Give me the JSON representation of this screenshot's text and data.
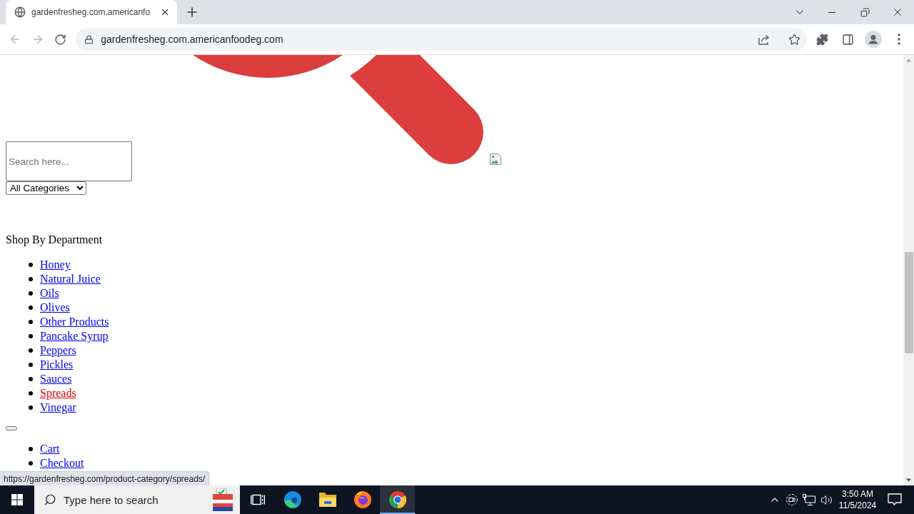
{
  "browser": {
    "tabs": [
      {
        "title": "gardenfresheg.com.americanfo",
        "selected": true
      }
    ],
    "nav_buttons": [
      {
        "kind": "back",
        "disabled": true
      },
      {
        "kind": "forward",
        "disabled": true
      },
      {
        "kind": "reload",
        "disabled": false
      }
    ],
    "address": "gardenfresheg.com.americanfoodeg.com",
    "status_url": "https://gardenfresheg.com/product-category/spreads/"
  },
  "page": {
    "search": {
      "placeholder": "Search here..."
    },
    "category_select": {
      "value": "All Categories"
    },
    "heading": "Shop By Department",
    "departments": [
      {
        "label": "Honey",
        "hovered": false
      },
      {
        "label": "Natural Juice",
        "hovered": false
      },
      {
        "label": "Oils",
        "hovered": false
      },
      {
        "label": "Olives",
        "hovered": false
      },
      {
        "label": "Other Products",
        "hovered": false
      },
      {
        "label": "Pancake Syrup",
        "hovered": false
      },
      {
        "label": "Peppers",
        "hovered": false
      },
      {
        "label": "Pickles",
        "hovered": false
      },
      {
        "label": "Sauces",
        "hovered": false
      },
      {
        "label": "Spreads",
        "hovered": true
      },
      {
        "label": "Vinegar",
        "hovered": false
      }
    ],
    "account_links": [
      {
        "label": "Cart"
      },
      {
        "label": "Checkout"
      }
    ]
  },
  "taskbar": {
    "search_placeholder": "Type here to search",
    "apps": [
      {
        "kind": "task-view",
        "active": false
      },
      {
        "kind": "edge",
        "active": false
      },
      {
        "kind": "explorer",
        "active": false
      },
      {
        "kind": "firefox",
        "active": false
      },
      {
        "kind": "chrome",
        "active": true
      }
    ],
    "time": "3:50 AM",
    "date": "11/5/2024"
  }
}
